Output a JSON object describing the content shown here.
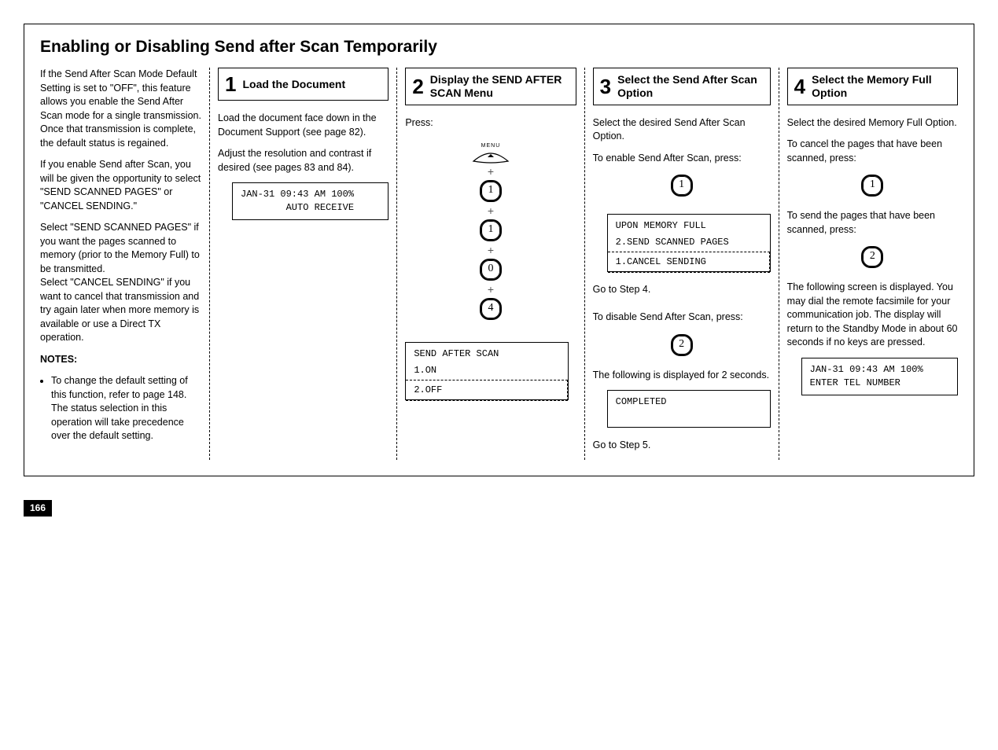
{
  "title": "Enabling or Disabling Send after Scan Temporarily",
  "page_number": "166",
  "intro": {
    "p1": "If the Send After Scan Mode Default Setting is set to \"OFF\", this feature allows you enable the Send After Scan mode for a single transmission. Once that transmission is complete, the default status is regained.",
    "p2": "If you enable Send after Scan, you will be given the opportunity to select \"SEND SCANNED PAGES\" or \"CANCEL SENDING.\"",
    "p3": "Select \"SEND SCANNED PAGES\" if you want the pages scanned to memory (prior to the Memory Full) to be transmitted.",
    "p4": "Select \"CANCEL SENDING\" if you want to cancel that transmission and try again later when more memory is available or use a Direct TX operation.",
    "notes_heading": "NOTES:",
    "note1": "To change the default setting of this function, refer to page 148. The status selection in this operation will take precedence over the default setting."
  },
  "step1": {
    "num": "1",
    "title": "Load the Document",
    "p1": "Load the document face down in the Document Support (see page 82).",
    "p2": "Adjust the resolution and contrast if desired (see pages 83 and 84).",
    "lcd1_l1": "JAN-31 09:43 AM 100%",
    "lcd1_l2": "        AUTO RECEIVE"
  },
  "step2": {
    "num": "2",
    "title": "Display the SEND AFTER SCAN Menu",
    "press": "Press:",
    "menu_label": "MENU",
    "k1": "1",
    "k2": "1",
    "k3": "0",
    "k4": "4",
    "lcd_l1": "SEND AFTER SCAN",
    "lcd_l2": "1.ON",
    "lcd_l3": "2.OFF"
  },
  "step3": {
    "num": "3",
    "title": "Select the Send After Scan Option",
    "p1": "Select the desired Send After Scan Option.",
    "p2": "To enable Send After Scan, press:",
    "k1": "1",
    "lcd_l1": "UPON MEMORY FULL",
    "lcd_l2": "2.SEND SCANNED PAGES",
    "lcd_l3": "1.CANCEL SENDING",
    "p3": "Go to Step 4.",
    "p4": "To disable Send After Scan, press:",
    "k2": "2",
    "p5": "The following is displayed for 2 seconds.",
    "lcd2": "COMPLETED",
    "p6": "Go to Step 5."
  },
  "step4": {
    "num": "4",
    "title": "Select the Memory Full Option",
    "p1": "Select the desired Memory Full Option.",
    "p2": "To cancel the pages that have been scanned, press:",
    "k1": "1",
    "p3": "To send the pages that have been scanned, press:",
    "k2": "2",
    "p4": "The following screen is displayed. You may dial the remote facsimile for your communication job. The display will return to the Standby Mode in about 60 seconds if no keys are pressed.",
    "lcd_l1": "JAN-31 09:43 AM 100%",
    "lcd_l2": "ENTER TEL NUMBER"
  }
}
